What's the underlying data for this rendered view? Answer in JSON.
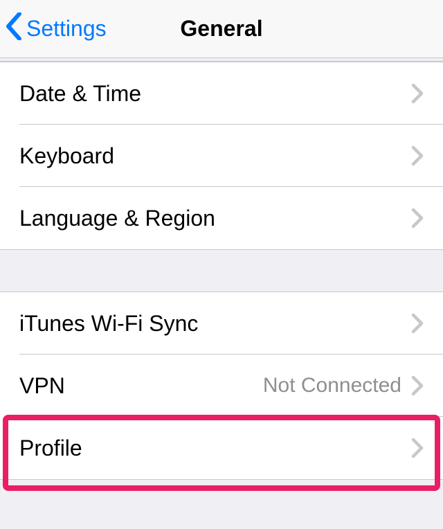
{
  "nav": {
    "back_label": "Settings",
    "title": "General"
  },
  "group1": [
    {
      "label": "Date & Time"
    },
    {
      "label": "Keyboard"
    },
    {
      "label": "Language & Region"
    }
  ],
  "group2": [
    {
      "label": "iTunes Wi-Fi Sync",
      "value": ""
    },
    {
      "label": "VPN",
      "value": "Not Connected"
    },
    {
      "label": "Profile",
      "value": ""
    }
  ],
  "colors": {
    "tint": "#007aff",
    "highlight": "#e91e63"
  }
}
